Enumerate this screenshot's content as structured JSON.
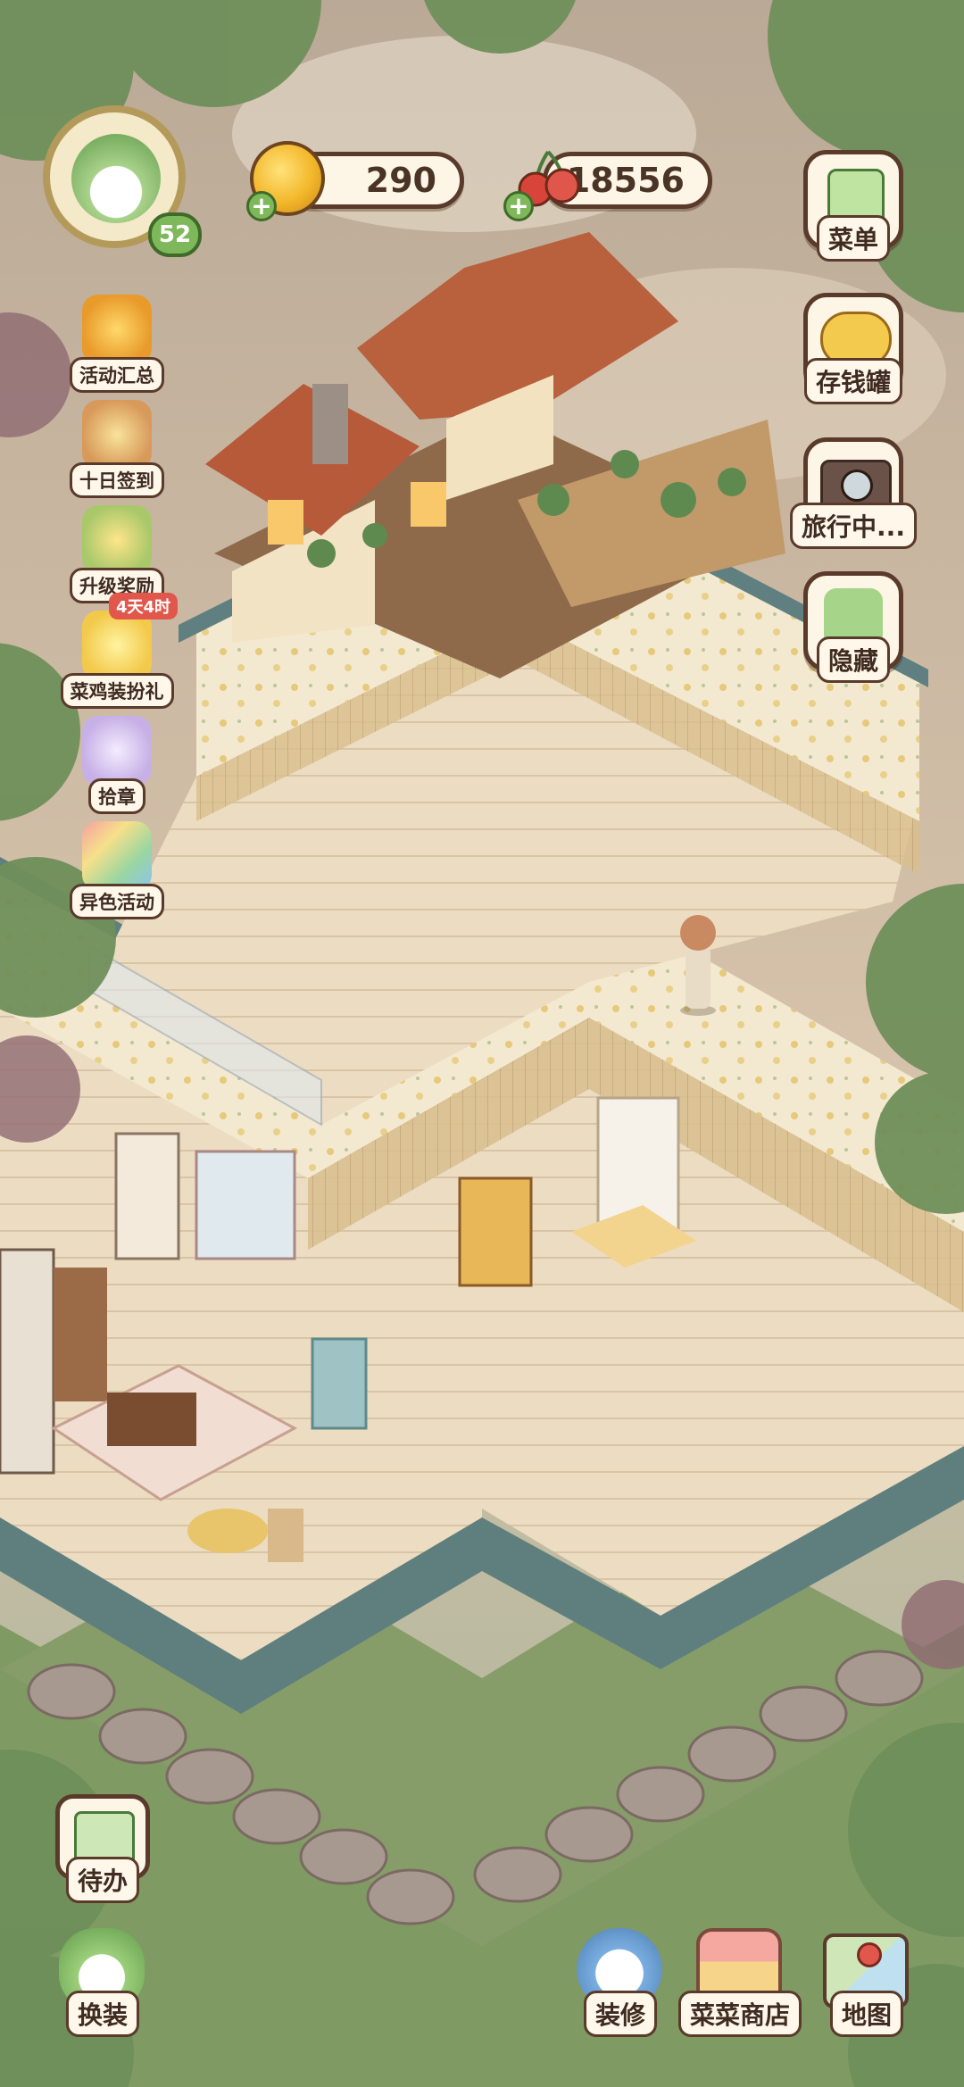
{
  "player": {
    "level": "52"
  },
  "currency": {
    "coins": "290",
    "cherries": "18556"
  },
  "left_menu": [
    {
      "label": "活动汇总",
      "icon": "trophy-pile-icon"
    },
    {
      "label": "十日签到",
      "icon": "gift-basket-icon"
    },
    {
      "label": "升级奖励",
      "icon": "level-up-icon"
    },
    {
      "label": "菜鸡装扮礼",
      "icon": "chick-costume-icon",
      "badge": "4天4时"
    },
    {
      "label": "拾章",
      "icon": "sticker-bag-icon"
    },
    {
      "label": "异色活动",
      "icon": "rainbow-card-icon"
    }
  ],
  "right_menu": [
    {
      "label": "菜单",
      "icon": "menu-list-icon"
    },
    {
      "label": "存钱罐",
      "icon": "piggy-bank-icon"
    },
    {
      "label": "旅行中...",
      "icon": "camera-icon"
    },
    {
      "label": "隐藏",
      "icon": "hide-frame-icon"
    }
  ],
  "bottom_left": [
    {
      "label": "待办",
      "icon": "todo-clipboard-icon"
    },
    {
      "label": "换装",
      "icon": "wardrobe-icon"
    }
  ],
  "bottom_right": [
    {
      "label": "装修",
      "icon": "renovate-chick-icon"
    },
    {
      "label": "菜菜商店",
      "icon": "shop-icon"
    },
    {
      "label": "地图",
      "icon": "map-icon"
    }
  ],
  "colors": {
    "accent_green": "#7fb85a",
    "frame_brown": "#5a3a2a",
    "badge_red": "#e2574c",
    "pill_bg": "#fdf6e6"
  }
}
